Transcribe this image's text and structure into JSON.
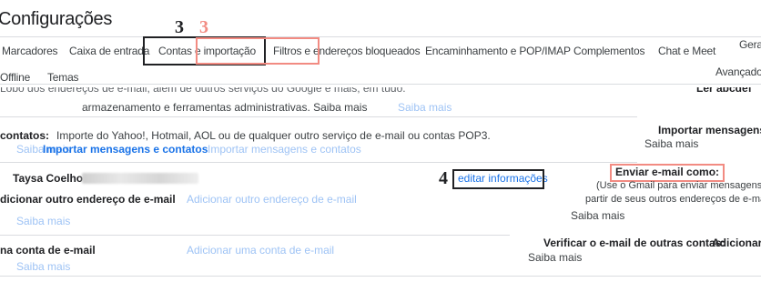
{
  "header": {
    "title": "Configurações"
  },
  "tabs": {
    "row1": [
      "Marcadores",
      "Caixa de entrada",
      "Contas e importação",
      "Filtros e endereços bloqueados",
      "Encaminhamento e POP/IMAP",
      "Complementos",
      "Chat e Meet",
      "Geral"
    ],
    "row2": [
      "Offline",
      "Temas"
    ],
    "advanced": "Avançado"
  },
  "annotations": {
    "n3_dark": "3",
    "n3_red": "3",
    "n4": "4"
  },
  "top_section": {
    "cropped_text": "Lóbo dos endereços de e-mail, além de outros serviços do Google e mais, em tudo.",
    "text": "armazenamento e ferramentas administrativas. Saiba mais",
    "saiba_mais_faded": "Saiba mais",
    "right_cropped": "Ler abcdef"
  },
  "import_section": {
    "label": "contatos:",
    "description": "Importe do Yahoo!, Hotmail, AOL ou de qualquer outro serviço de e-mail ou contas POP3.",
    "faded_left": "Saiba mais",
    "link": "Importar mensagens e contatos",
    "faded_link": "Importar mensagens e contatos",
    "right_label": "Importar mensagens e",
    "right_saiba": "Saiba mais"
  },
  "send_as": {
    "name": "Taysa Coelho",
    "edit_link": "editar informações",
    "add_label": "dicionar outro endereço de e-mail",
    "add_faded": "Adicionar outro endereço de e-mail",
    "saiba_faded": "Saiba mais",
    "right_title": "Enviar e-mail como:",
    "right_desc1": "(Use o Gmail para enviar mensagens a",
    "right_desc2": "partir de seus outros endereços de e-mail.)",
    "right_saiba": "Saiba mais"
  },
  "check_mail": {
    "label": "na conta de e-mail",
    "faded_link": "Adicionar uma conta de e-mail",
    "faded_saiba": "Saiba mais",
    "right_title": "Verificar o e-mail de outras contas:",
    "right_link": "Adicionar u",
    "right_saiba": "Saiba mais"
  }
}
